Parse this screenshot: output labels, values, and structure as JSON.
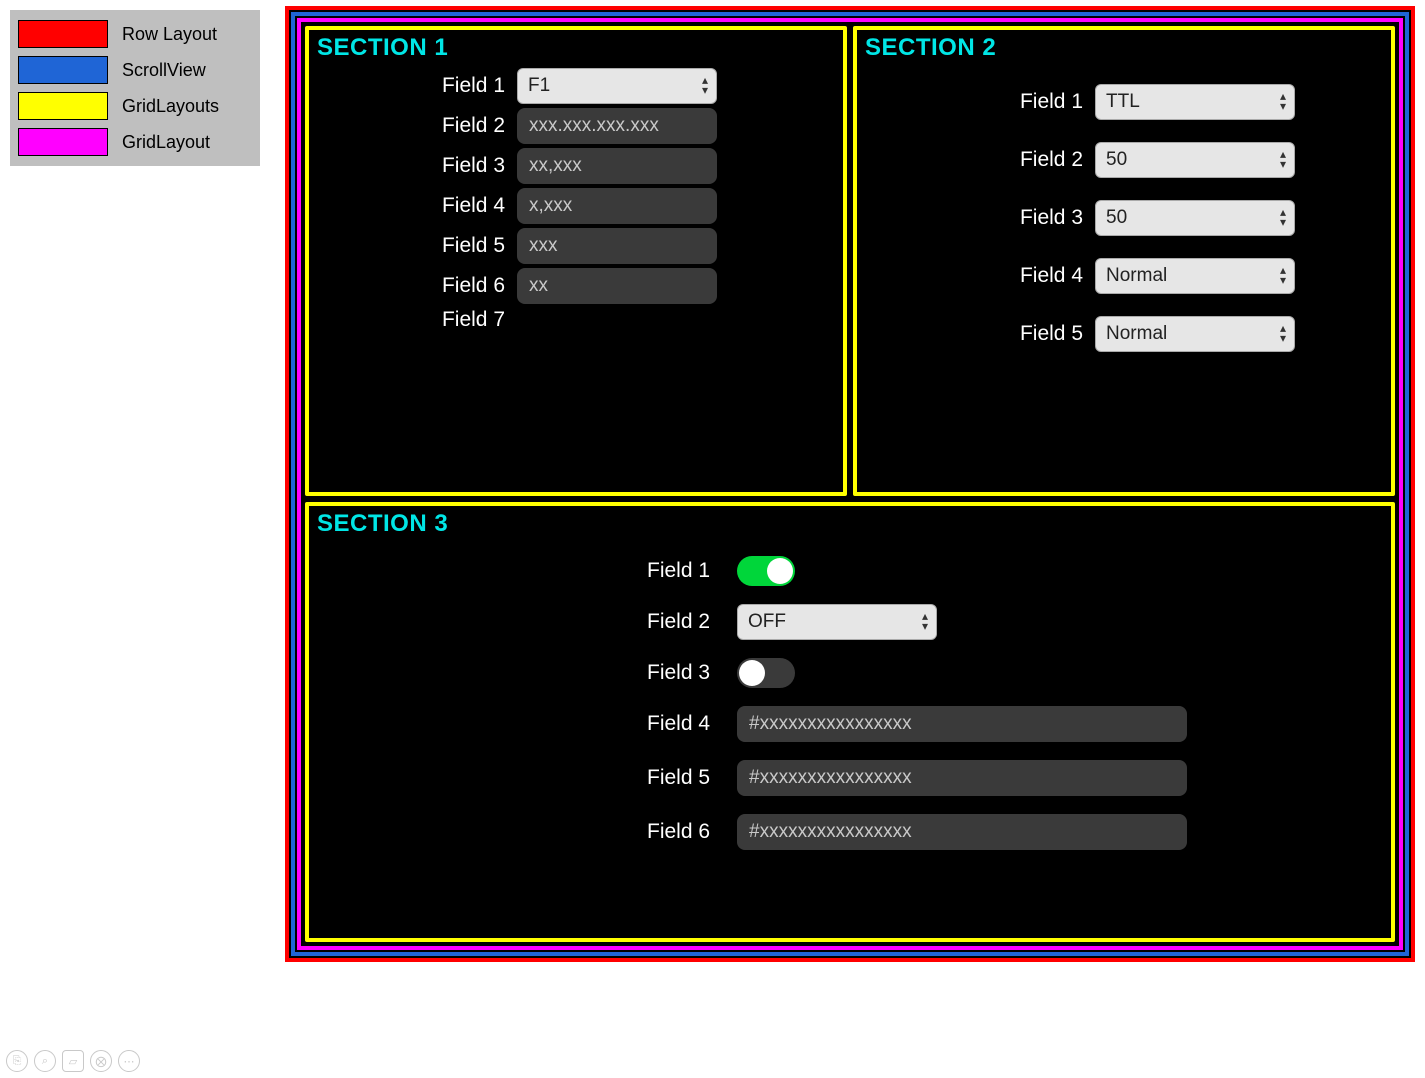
{
  "legend": {
    "items": [
      {
        "color": "#ff0000",
        "label": "Row Layout"
      },
      {
        "color": "#1f65d6",
        "label": "ScrollView"
      },
      {
        "color": "#ffff00",
        "label": "GridLayouts"
      },
      {
        "color": "#ff00ff",
        "label": "GridLayout"
      }
    ]
  },
  "section1": {
    "title": "SECTION 1",
    "fields": {
      "f1_label": "Field 1",
      "f1_value": "F1",
      "f2_label": "Field 2",
      "f2_value": "xxx.xxx.xxx.xxx",
      "f3_label": "Field 3",
      "f3_value": "xx,xxx",
      "f4_label": "Field 4",
      "f4_value": "x,xxx",
      "f5_label": "Field 5",
      "f5_value": "xxx",
      "f6_label": "Field 6",
      "f6_value": "xx",
      "f7_label": "Field 7"
    }
  },
  "section2": {
    "title": "SECTION 2",
    "fields": {
      "f1_label": "Field 1",
      "f1_value": "TTL",
      "f2_label": "Field 2",
      "f2_value": "50",
      "f3_label": "Field 3",
      "f3_value": "50",
      "f4_label": "Field 4",
      "f4_value": "Normal",
      "f5_label": "Field 5",
      "f5_value": "Normal"
    }
  },
  "section3": {
    "title": "SECTION 3",
    "fields": {
      "f1_label": "Field 1",
      "f1_state": "on",
      "f2_label": "Field 2",
      "f2_value": "OFF",
      "f3_label": "Field 3",
      "f3_state": "off",
      "f4_label": "Field 4",
      "f4_value": "#xxxxxxxxxxxxxxxx",
      "f5_label": "Field 5",
      "f5_value": "#xxxxxxxxxxxxxxxx",
      "f6_label": "Field 6",
      "f6_value": "#xxxxxxxxxxxxxxxx"
    }
  }
}
